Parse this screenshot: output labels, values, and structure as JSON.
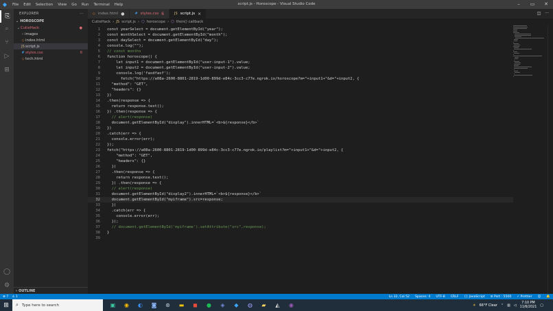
{
  "window": {
    "title": "script.js - Horoscope - Visual Studio Code",
    "menu": [
      "File",
      "Edit",
      "Selection",
      "View",
      "Go",
      "Run",
      "Terminal",
      "Help"
    ]
  },
  "sidebar": {
    "header": "EXPLORER",
    "header_more": "···",
    "workspace": "HOROSCOPE",
    "items": [
      {
        "label": "CutieHack",
        "badge": "●"
      },
      {
        "label": "images",
        "badge": ""
      },
      {
        "label": "index.html",
        "badge": ""
      },
      {
        "label": "script.js",
        "badge": ""
      },
      {
        "label": "styles.css",
        "badge": "6"
      },
      {
        "label": "tech.html",
        "badge": ""
      }
    ],
    "outline": "OUTLINE"
  },
  "tabs": [
    {
      "label": "index.html",
      "status": "●"
    },
    {
      "label": "styles.css",
      "status": "6"
    },
    {
      "label": "script.js",
      "status": "×"
    }
  ],
  "breadcrumb": [
    "CutieHack",
    "script.js",
    "horoscope",
    "then() callback"
  ],
  "code": {
    "current_line": 32,
    "lines": [
      {
        "n": "1",
        "t": "const yearSelect = document.getElementById(\"year\");"
      },
      {
        "n": "2",
        "t": "const monthSelect = document.getElementById(\"month\");"
      },
      {
        "n": "3",
        "t": "const daySelect = document.getElementById(\"day\");"
      },
      {
        "n": "4",
        "t": "console.log(\"\");"
      },
      {
        "n": "5",
        "t": "// const months"
      },
      {
        "n": "6",
        "t": "function horoscope() {"
      },
      {
        "n": "7",
        "t": "    let input1 = document.getElementById(\"user-input-1\").value;"
      },
      {
        "n": "8",
        "t": "    let input2 = document.getElementById(\"user-input-2\").value;"
      },
      {
        "n": "9",
        "t": "    console.log('fasdfasf');"
      },
      {
        "n": "10",
        "t": "      fetch(\"https://a08a-2600-8801-2819-1d00-899d-e84c-3cc3-c77e.ngrok.io/horoscope?m=\"+input1+\"&d=\"+input2, {"
      },
      {
        "n": "11",
        "t": "  \"method\": \"GET\","
      },
      {
        "n": "12",
        "t": "  \"headers\": {}"
      },
      {
        "n": "13",
        "t": "})"
      },
      {
        "n": "14",
        "t": ".then(response => {"
      },
      {
        "n": "15",
        "t": "  return response.text();"
      },
      {
        "n": "16",
        "t": "}) .then(response => {"
      },
      {
        "n": "17",
        "t": "  // alert(response)"
      },
      {
        "n": "18",
        "t": "  document.getElementById(\"display\").innerHTML=`<b>${response}</b>`"
      },
      {
        "n": "19",
        "t": "})"
      },
      {
        "n": "20",
        "t": ".catch(err => {"
      },
      {
        "n": "21",
        "t": "  console.error(err);"
      },
      {
        "n": "22",
        "t": "});"
      },
      {
        "n": "23",
        "t": "fetch(\"https://a08a-2600-8801-2819-1d00-899d-e84c-3cc3-c77e.ngrok.io/playlist?m=\"+input1+\"&d=\"+input2, {"
      },
      {
        "n": "24",
        "t": "    \"method\": \"GET\","
      },
      {
        "n": "25",
        "t": "    \"headers\": {}"
      },
      {
        "n": "26",
        "t": "  })"
      },
      {
        "n": "27",
        "t": "  .then(response => {"
      },
      {
        "n": "28",
        "t": "    return response.text();"
      },
      {
        "n": "29",
        "t": "  }) .then(response => {"
      },
      {
        "n": "30",
        "t": "  // alert(response)"
      },
      {
        "n": "31",
        "t": "  document.getElementById(\"display2\").innerHTML=`<b>${response}</b>`"
      },
      {
        "n": "32",
        "t": "  document.getElementById(\"myiframe\").src=response;"
      },
      {
        "n": "33",
        "t": "  })"
      },
      {
        "n": "34",
        "t": "  .catch(err => {"
      },
      {
        "n": "35",
        "t": "    console.error(err);"
      },
      {
        "n": "36",
        "t": "  });"
      },
      {
        "n": "37",
        "t": "  // document.getElementById('myiframe').setAttribute(\"src\",response);"
      },
      {
        "n": "38",
        "t": "}"
      },
      {
        "n": "39",
        "t": ""
      }
    ]
  },
  "statusbar": {
    "left": [
      "⊗ 7",
      "⚠ 1"
    ],
    "right": [
      "Ln 32, Col 52",
      "Spaces: 4",
      "UTF-8",
      "CRLF",
      "{} JavaScript",
      "⊘ Port : 5500",
      "✓ Prettier"
    ]
  },
  "taskbar": {
    "search_placeholder": "Type here to search",
    "weather": "66°F  Clear",
    "time": "7:10 PM",
    "date": "11/6/2021"
  },
  "colors": {
    "accent": "#007acc",
    "editor_bg": "#1e1e1e",
    "sidebar_bg": "#252526"
  }
}
